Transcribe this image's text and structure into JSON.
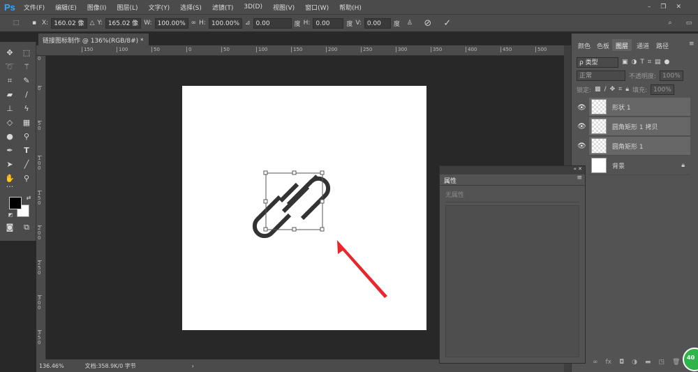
{
  "app": {
    "logo": "Ps"
  },
  "menu": [
    "文件(F)",
    "编辑(E)",
    "图像(I)",
    "图层(L)",
    "文字(Y)",
    "选择(S)",
    "滤镜(T)",
    "3D(D)",
    "视图(V)",
    "窗口(W)",
    "帮助(H)"
  ],
  "options": {
    "x_label": "X:",
    "x": "160.02 像",
    "y_label": "Y:",
    "y": "165.02 像",
    "w_label": "W:",
    "w": "100.00%",
    "h_label": "H:",
    "h": "100.00%",
    "angle": "0.00",
    "deg": "度",
    "hskew_label": "H:",
    "hskew": "0.00",
    "vskew_label": "V:",
    "vskew": "0.00"
  },
  "document": {
    "tab_title": "链接图标制作 @ 136%(RGB/8#) *",
    "close": "×",
    "zoom": "136.46%",
    "doc_info": "文档:358.9K/0 字节",
    "arrow": "›"
  },
  "rulers": {
    "h": [
      "150",
      "100",
      "50",
      "0",
      "50",
      "100",
      "150",
      "200",
      "250",
      "300",
      "350",
      "400",
      "450",
      "500"
    ],
    "v": [
      "50",
      "0",
      "50",
      "100",
      "150",
      "200",
      "250",
      "300",
      "350"
    ]
  },
  "panel": {
    "tabs": [
      "颜色",
      "色板",
      "图层",
      "通道",
      "路径"
    ],
    "active_tab": "图层",
    "filter": "ρ 类型",
    "blend_mode": "正常",
    "opacity_label": "不透明度:",
    "opacity": "100%",
    "lock_label": "锁定:",
    "fill_label": "填充:",
    "fill": "100%",
    "layers": [
      {
        "name": "形状 1",
        "visible": true
      },
      {
        "name": "圆角矩形 1 拷贝",
        "visible": true
      },
      {
        "name": "圆角矩形 1",
        "visible": true
      },
      {
        "name": "背景",
        "visible": false,
        "locked": true
      }
    ]
  },
  "properties": {
    "title": "属性",
    "empty": "无属性"
  },
  "badge": "40",
  "colors": {
    "accent": "#31a8ff",
    "arrow": "#e8262c",
    "foreground": "#000000",
    "background": "#ffffff"
  }
}
